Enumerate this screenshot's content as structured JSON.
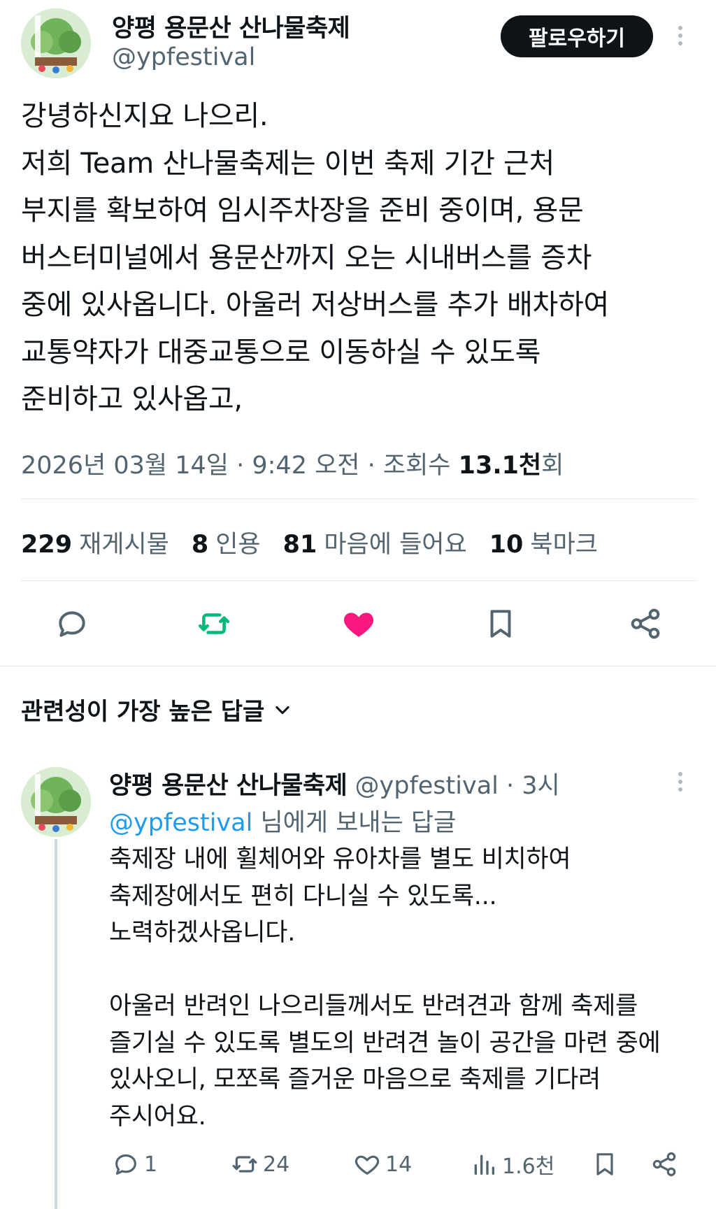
{
  "colors": {
    "text_primary": "#0f1419",
    "text_secondary": "#536471",
    "link": "#1d9bf0",
    "retweet_green": "#00ba7c",
    "like_pink": "#f91880",
    "follow_button_bg": "#0f1419"
  },
  "tweet": {
    "display_name": "양평 용문산 산나물축제",
    "handle": "@ypfestival",
    "follow_label": "팔로우하기",
    "text": "강녕하신지요 나으리.\n저희 Team 산나물축제는 이번 축제 기간 근처\n부지를 확보하여 임시주차장을 준비 중이며, 용문\n버스터미널에서 용문산까지 오는 시내버스를 증차\n중에 있사옵니다. 아울러 저상버스를 추가 배차하여\n교통약자가 대중교통으로 이동하실 수 있도록\n준비하고 있사옵고,",
    "meta_prefix": "2026년 03월 14일 · 9:42 오전 · 조회수 ",
    "meta_views": "13.1천",
    "meta_suffix": "회",
    "stats": [
      {
        "num": "229",
        "label": "재게시물"
      },
      {
        "num": "8",
        "label": "인용"
      },
      {
        "num": "81",
        "label": "마음에 들어요"
      },
      {
        "num": "10",
        "label": "북마크"
      }
    ],
    "liked": true
  },
  "replies_sort_label": "관련성이 가장 높은 답글",
  "reply": {
    "display_name": "양평 용문산 산나물축제",
    "handle_time": "@ypfestival · 3시",
    "reply_to_mention": "@ypfestival",
    "reply_to_suffix": " 님에게 보내는 답글",
    "text": "축제장 내에 휠체어와 유아차를 별도 비치하여\n축제장에서도 편히 다니실 수 있도록...\n노력하겠사옵니다.\n\n아울러 반려인 나으리들께서도 반려견과 함께 축제를\n즐기실 수 있도록 별도의 반려견 놀이 공간을 마련 중에\n있사오니, 모쪼록 즐거운 마음으로 축제를 기다려\n주시어요.",
    "reply_count": "1",
    "retweet_count": "24",
    "like_count": "14",
    "view_count": "1.6천"
  }
}
